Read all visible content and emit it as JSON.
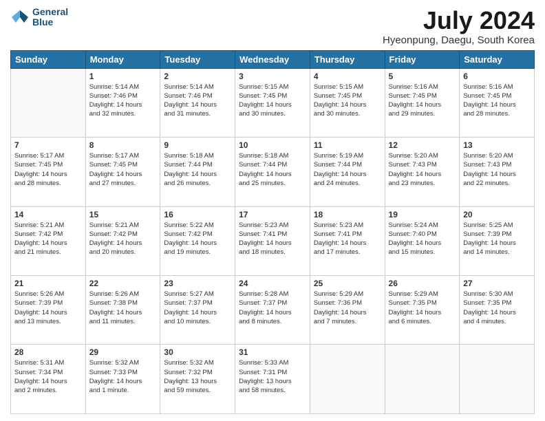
{
  "header": {
    "logo_line1": "General",
    "logo_line2": "Blue",
    "month": "July 2024",
    "location": "Hyeonpung, Daegu, South Korea"
  },
  "weekdays": [
    "Sunday",
    "Monday",
    "Tuesday",
    "Wednesday",
    "Thursday",
    "Friday",
    "Saturday"
  ],
  "weeks": [
    [
      {
        "day": "",
        "info": ""
      },
      {
        "day": "1",
        "info": "Sunrise: 5:14 AM\nSunset: 7:46 PM\nDaylight: 14 hours\nand 32 minutes."
      },
      {
        "day": "2",
        "info": "Sunrise: 5:14 AM\nSunset: 7:46 PM\nDaylight: 14 hours\nand 31 minutes."
      },
      {
        "day": "3",
        "info": "Sunrise: 5:15 AM\nSunset: 7:45 PM\nDaylight: 14 hours\nand 30 minutes."
      },
      {
        "day": "4",
        "info": "Sunrise: 5:15 AM\nSunset: 7:45 PM\nDaylight: 14 hours\nand 30 minutes."
      },
      {
        "day": "5",
        "info": "Sunrise: 5:16 AM\nSunset: 7:45 PM\nDaylight: 14 hours\nand 29 minutes."
      },
      {
        "day": "6",
        "info": "Sunrise: 5:16 AM\nSunset: 7:45 PM\nDaylight: 14 hours\nand 28 minutes."
      }
    ],
    [
      {
        "day": "7",
        "info": "Sunrise: 5:17 AM\nSunset: 7:45 PM\nDaylight: 14 hours\nand 28 minutes."
      },
      {
        "day": "8",
        "info": "Sunrise: 5:17 AM\nSunset: 7:45 PM\nDaylight: 14 hours\nand 27 minutes."
      },
      {
        "day": "9",
        "info": "Sunrise: 5:18 AM\nSunset: 7:44 PM\nDaylight: 14 hours\nand 26 minutes."
      },
      {
        "day": "10",
        "info": "Sunrise: 5:18 AM\nSunset: 7:44 PM\nDaylight: 14 hours\nand 25 minutes."
      },
      {
        "day": "11",
        "info": "Sunrise: 5:19 AM\nSunset: 7:44 PM\nDaylight: 14 hours\nand 24 minutes."
      },
      {
        "day": "12",
        "info": "Sunrise: 5:20 AM\nSunset: 7:43 PM\nDaylight: 14 hours\nand 23 minutes."
      },
      {
        "day": "13",
        "info": "Sunrise: 5:20 AM\nSunset: 7:43 PM\nDaylight: 14 hours\nand 22 minutes."
      }
    ],
    [
      {
        "day": "14",
        "info": "Sunrise: 5:21 AM\nSunset: 7:42 PM\nDaylight: 14 hours\nand 21 minutes."
      },
      {
        "day": "15",
        "info": "Sunrise: 5:21 AM\nSunset: 7:42 PM\nDaylight: 14 hours\nand 20 minutes."
      },
      {
        "day": "16",
        "info": "Sunrise: 5:22 AM\nSunset: 7:42 PM\nDaylight: 14 hours\nand 19 minutes."
      },
      {
        "day": "17",
        "info": "Sunrise: 5:23 AM\nSunset: 7:41 PM\nDaylight: 14 hours\nand 18 minutes."
      },
      {
        "day": "18",
        "info": "Sunrise: 5:23 AM\nSunset: 7:41 PM\nDaylight: 14 hours\nand 17 minutes."
      },
      {
        "day": "19",
        "info": "Sunrise: 5:24 AM\nSunset: 7:40 PM\nDaylight: 14 hours\nand 15 minutes."
      },
      {
        "day": "20",
        "info": "Sunrise: 5:25 AM\nSunset: 7:39 PM\nDaylight: 14 hours\nand 14 minutes."
      }
    ],
    [
      {
        "day": "21",
        "info": "Sunrise: 5:26 AM\nSunset: 7:39 PM\nDaylight: 14 hours\nand 13 minutes."
      },
      {
        "day": "22",
        "info": "Sunrise: 5:26 AM\nSunset: 7:38 PM\nDaylight: 14 hours\nand 11 minutes."
      },
      {
        "day": "23",
        "info": "Sunrise: 5:27 AM\nSunset: 7:37 PM\nDaylight: 14 hours\nand 10 minutes."
      },
      {
        "day": "24",
        "info": "Sunrise: 5:28 AM\nSunset: 7:37 PM\nDaylight: 14 hours\nand 8 minutes."
      },
      {
        "day": "25",
        "info": "Sunrise: 5:29 AM\nSunset: 7:36 PM\nDaylight: 14 hours\nand 7 minutes."
      },
      {
        "day": "26",
        "info": "Sunrise: 5:29 AM\nSunset: 7:35 PM\nDaylight: 14 hours\nand 6 minutes."
      },
      {
        "day": "27",
        "info": "Sunrise: 5:30 AM\nSunset: 7:35 PM\nDaylight: 14 hours\nand 4 minutes."
      }
    ],
    [
      {
        "day": "28",
        "info": "Sunrise: 5:31 AM\nSunset: 7:34 PM\nDaylight: 14 hours\nand 2 minutes."
      },
      {
        "day": "29",
        "info": "Sunrise: 5:32 AM\nSunset: 7:33 PM\nDaylight: 14 hours\nand 1 minute."
      },
      {
        "day": "30",
        "info": "Sunrise: 5:32 AM\nSunset: 7:32 PM\nDaylight: 13 hours\nand 59 minutes."
      },
      {
        "day": "31",
        "info": "Sunrise: 5:33 AM\nSunset: 7:31 PM\nDaylight: 13 hours\nand 58 minutes."
      },
      {
        "day": "",
        "info": ""
      },
      {
        "day": "",
        "info": ""
      },
      {
        "day": "",
        "info": ""
      }
    ]
  ]
}
